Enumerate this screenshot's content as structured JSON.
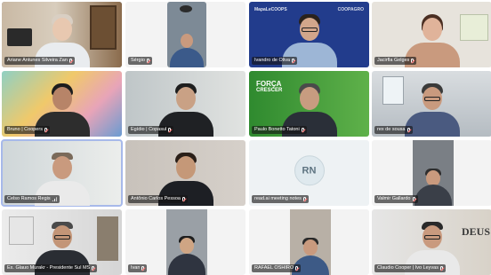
{
  "colors": {
    "tile_outline_active": "#a7b9ea",
    "name_tag_bg": "rgba(20,20,20,0.62)",
    "avatar_bg": "#dfe9ee",
    "brand_blue": "#223c8c",
    "brand_green": "#2f8a2f"
  },
  "tiles": [
    {
      "name": "Ariane Antunes Silveira Zan",
      "mic": "muted"
    },
    {
      "name": "Sérgio",
      "mic": "muted"
    },
    {
      "name": "Ivandro de Oliva",
      "mic": "muted"
    },
    {
      "name": "Jacirfla Gelges",
      "mic": "muted"
    },
    {
      "name": "Bruno | Coopers",
      "mic": "muted"
    },
    {
      "name": "Egídio | Copasul",
      "mic": "muted"
    },
    {
      "name": "Paulo Bonetto Tatoni",
      "mic": "muted"
    },
    {
      "name": "rex de sousa",
      "mic": "muted"
    },
    {
      "name": "Celso Ramos Regis",
      "mic": "active"
    },
    {
      "name": "Antônio Carlos Pessoa",
      "mic": "muted"
    },
    {
      "name": "read.ai meeting notes",
      "mic": "muted",
      "avatar_initials": "RN"
    },
    {
      "name": "Valmir Gallardo",
      "mic": "muted"
    },
    {
      "name": "Ex. Glauo Murakr - Presidente Sul MS",
      "mic": "muted"
    },
    {
      "name": "Ivan",
      "mic": "muted"
    },
    {
      "name": "RAFAEL OSHIRO",
      "mic": "muted"
    },
    {
      "name": "Claudio Cooper | Ivo Leyvas",
      "mic": "muted"
    }
  ],
  "logos": {
    "ivandro_brand": "MapaLeCOOPS",
    "ivandro_brand_right": "COOPAGRO",
    "paulo_slogan_line1": "FORÇA",
    "paulo_slogan_line2": "CRESCER",
    "claudio_wall_text": "DEUS"
  }
}
